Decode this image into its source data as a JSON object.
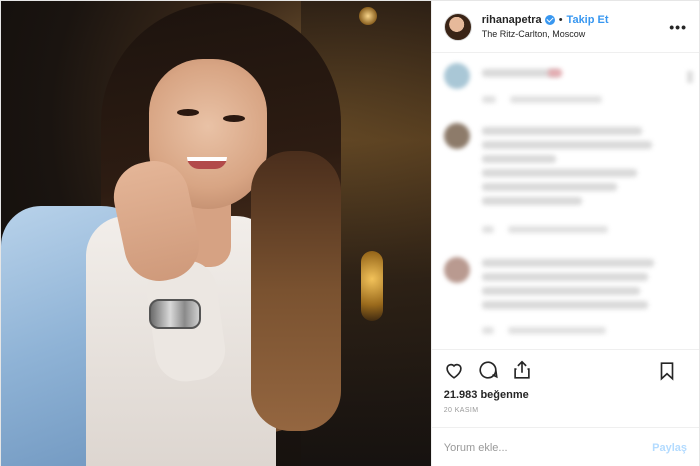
{
  "header": {
    "username": "rihanapetra",
    "separator": "•",
    "follow_label": "Takip Et",
    "location": "The Ritz-Carlton, Moscow",
    "more_icon": "more-horizontal-icon",
    "more_label": "•••"
  },
  "actions": {
    "like_icon": "heart-icon",
    "comment_icon": "comment-icon",
    "share_icon": "share-icon",
    "save_icon": "bookmark-icon"
  },
  "likes": {
    "text": "21.983 beğenme"
  },
  "date": {
    "text": "20 KASIM"
  },
  "composer": {
    "placeholder": "Yorum ekle...",
    "post_label": "Paylaş"
  },
  "colors": {
    "accent": "#3897f0",
    "post_disabled": "#b3dbff"
  }
}
